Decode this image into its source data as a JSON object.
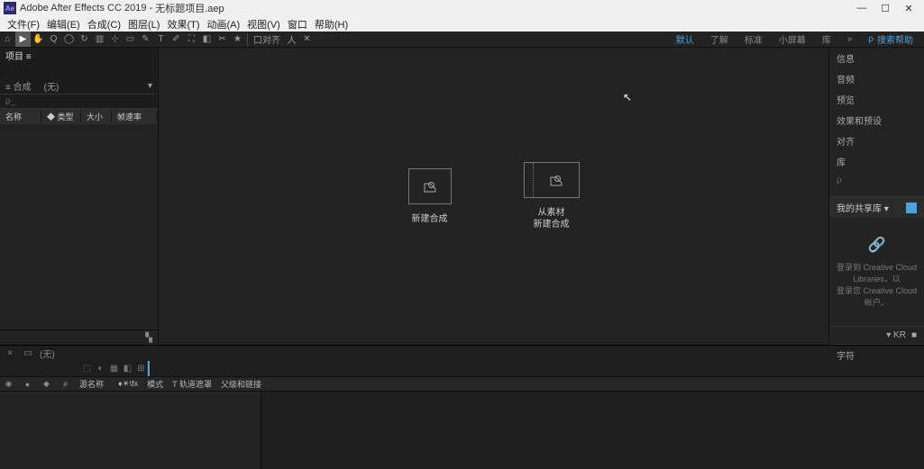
{
  "titlebar": {
    "app": "Adobe After Effects CC 2019",
    "project": "无标题项目.aep",
    "logo": "Ae"
  },
  "menu": [
    "文件(F)",
    "编辑(E)",
    "合成(C)",
    "图层(L)",
    "效果(T)",
    "动画(A)",
    "视图(V)",
    "窗口",
    "帮助(H)"
  ],
  "toolbar": {
    "snap": "口对齐",
    "right": {
      "default": "默认",
      "learn": "了解",
      "standard": "标准",
      "small": "小屏幕",
      "libs": "库",
      "searchHelp": "搜索帮助"
    }
  },
  "project": {
    "tab": "项目 ≡",
    "tabs2": {
      "compose": "≡ 合成",
      "none": "(无)"
    },
    "search": "ρ_",
    "cols": {
      "name": "名称",
      "type": "◆ 类型",
      "size": "大小",
      "rate": "帧速率"
    },
    "footerIcon": "▚"
  },
  "center": {
    "newComp": "新建合成",
    "fromFootage1": "从素材",
    "fromFootage2": "新建合成"
  },
  "rightPanel": {
    "rows": [
      "信息",
      "音频",
      "预览",
      "效果和预设",
      "对齐",
      "库"
    ],
    "searchPlaceholder": "ρ",
    "libs": {
      "title": "我的共享库 ▾",
      "msg1": "登录到 Creative Cloud Libraries，以",
      "msg2": "登录您 Creative Cloud 帐户。"
    },
    "char": {
      "title": "字符",
      "k": "▾ KR",
      "n": "■"
    }
  },
  "timeline": {
    "tab": "(无)",
    "time": "",
    "cols": {
      "idx": "#",
      "src": "源名称",
      "switches": "♦☀\\fx",
      "mode": "模式",
      "trk": "T 轨道遮罩",
      "parent": "父级和链接"
    }
  }
}
